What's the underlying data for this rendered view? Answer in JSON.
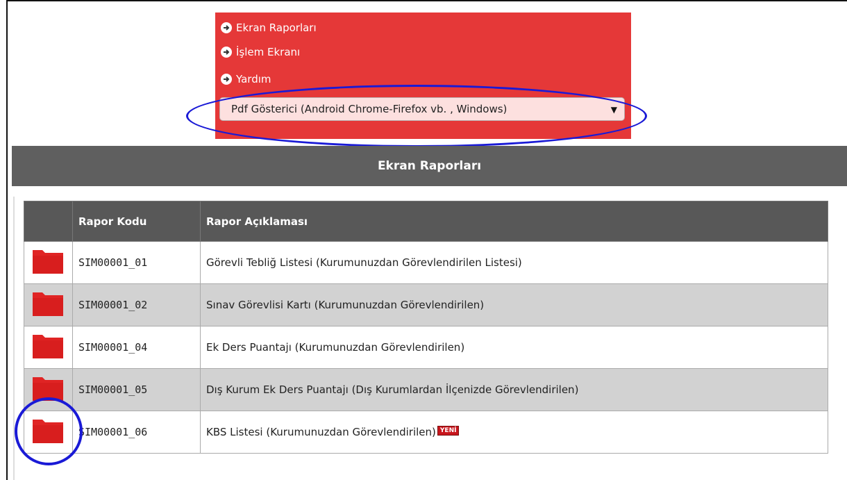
{
  "menu": {
    "items": [
      {
        "label": "Ekran Raporları"
      },
      {
        "label": "İşlem Ekranı"
      },
      {
        "label": "Yardım"
      }
    ]
  },
  "viewer_select": {
    "value": "Pdf Gösterici (Android Chrome-Firefox vb. , Windows)"
  },
  "section": {
    "title": "Ekran Raporları"
  },
  "table": {
    "headers": [
      "",
      "Rapor Kodu",
      "Rapor Açıklaması"
    ],
    "rows": [
      {
        "code": "SIM00001_01",
        "description": "Görevli Tebliğ Listesi (Kurumunuzdan Görevlendirilen Listesi)"
      },
      {
        "code": "SIM00001_02",
        "description": "Sınav Görevlisi Kartı (Kurumunuzdan Görevlendirilen)"
      },
      {
        "code": "SIM00001_04",
        "description": "Ek Ders Puantajı (Kurumunuzdan Görevlendirilen)"
      },
      {
        "code": "SIM00001_05",
        "description": "Dış Kurum Ek Ders Puantajı (Dış Kurumlardan İlçenizde Görevlendirilen)"
      },
      {
        "code": "SIM00001_06",
        "description": "KBS Listesi (Kurumunuzdan Görevlendirilen)",
        "badge": "YENİ"
      }
    ]
  },
  "colors": {
    "menu_bg": "#e53838",
    "header_bg": "#5f5f5f",
    "annotation": "#1a1ad6",
    "folder": "#e02424"
  }
}
